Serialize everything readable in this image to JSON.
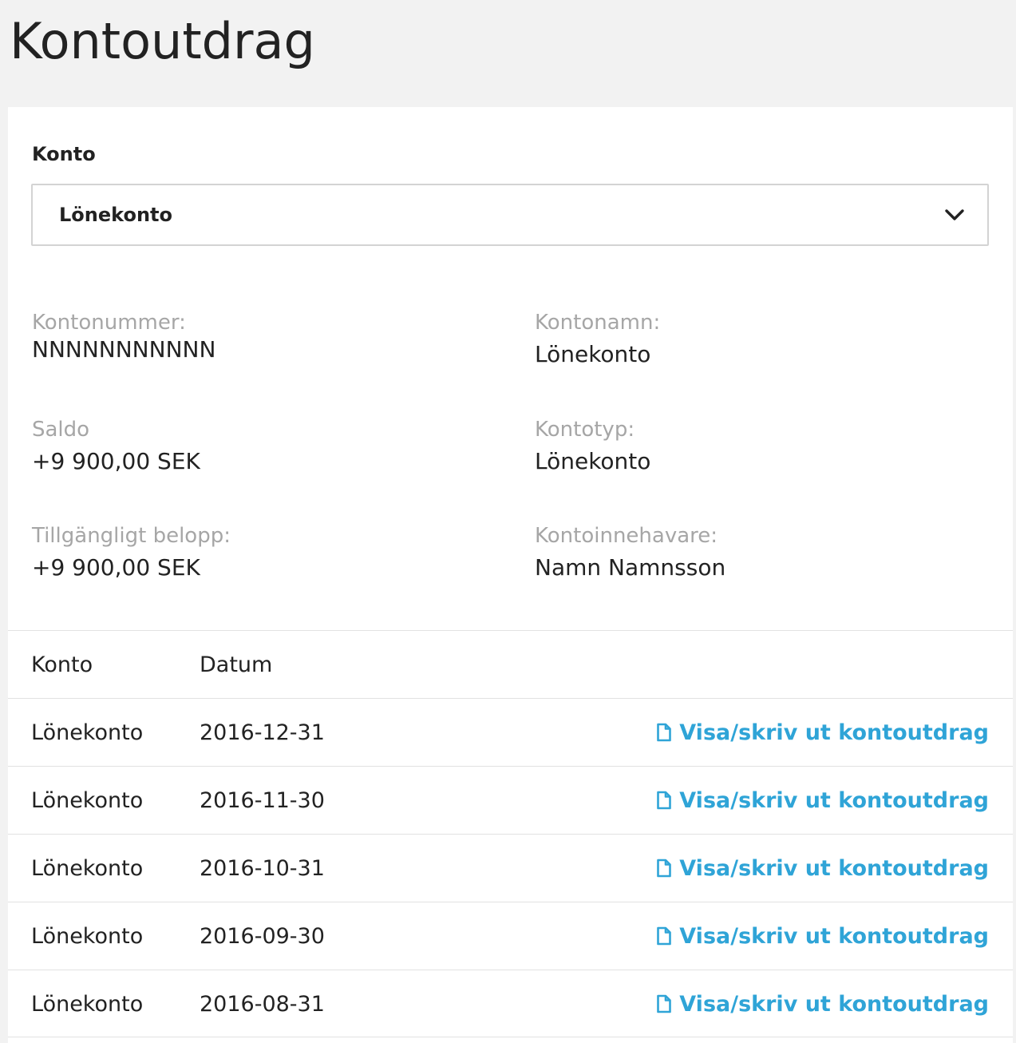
{
  "header": {
    "title": "Kontoutdrag"
  },
  "account_select": {
    "label": "Konto",
    "selected": "Lönekonto"
  },
  "details": {
    "kontonummer": {
      "label": "Kontonummer:",
      "value": "NNNNNNNNNNN"
    },
    "kontonamn": {
      "label": "Kontonamn:",
      "value": "Lönekonto"
    },
    "saldo": {
      "label": "Saldo",
      "value": "+9 900,00 SEK"
    },
    "kontotyp": {
      "label": "Kontotyp:",
      "value": "Lönekonto"
    },
    "tillgangligt": {
      "label": "Tillgängligt belopp:",
      "value": "+9 900,00 SEK"
    },
    "kontoinnehavare": {
      "label": "Kontoinnehavare:",
      "value": "Namn Namnsson"
    }
  },
  "table": {
    "headers": {
      "konto": "Konto",
      "datum": "Datum"
    },
    "rows": [
      {
        "konto": "Lönekonto",
        "datum": "2016-12-31",
        "action": "Visa/skriv ut kontoutdrag"
      },
      {
        "konto": "Lönekonto",
        "datum": "2016-11-30",
        "action": "Visa/skriv ut kontoutdrag"
      },
      {
        "konto": "Lönekonto",
        "datum": "2016-10-31",
        "action": "Visa/skriv ut kontoutdrag"
      },
      {
        "konto": "Lönekonto",
        "datum": "2016-09-30",
        "action": "Visa/skriv ut kontoutdrag"
      },
      {
        "konto": "Lönekonto",
        "datum": "2016-08-31",
        "action": "Visa/skriv ut kontoutdrag"
      }
    ]
  },
  "colors": {
    "link": "#2fa4d7",
    "label_gray": "#a6a6a6",
    "text": "#222222",
    "header_bg": "#f2f2f2",
    "divider": "#e2e2e2"
  },
  "icons": {
    "select_chevron": "chevron-down-icon",
    "row_action": "document-icon"
  }
}
